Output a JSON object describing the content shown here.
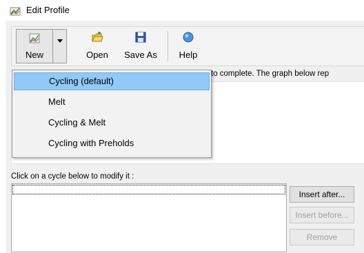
{
  "window": {
    "title": "Edit Profile",
    "icon": "chart-window-icon"
  },
  "toolbar": {
    "new_label": "New",
    "open_label": "Open",
    "saveas_label": "Save As",
    "help_label": "Help",
    "icons": {
      "new": "new-chart-icon",
      "open": "open-folder-icon",
      "saveas": "floppy-disk-icon",
      "help": "help-globe-icon"
    }
  },
  "main": {
    "description": "to complete. The graph below rep",
    "modify_label": "Click on a cycle below to modify it :"
  },
  "buttons": {
    "insert_after": "Insert after...",
    "insert_before": "Insert before...",
    "remove": "Remove"
  },
  "menu": {
    "items": [
      {
        "label": "Cycling (default)",
        "highlighted": true
      },
      {
        "label": "Melt"
      },
      {
        "label": "Cycling & Melt"
      },
      {
        "label": "Cycling with Preholds"
      }
    ]
  },
  "colors": {
    "highlight": "#91c9f7",
    "window_bg": "#f0f0f0"
  }
}
